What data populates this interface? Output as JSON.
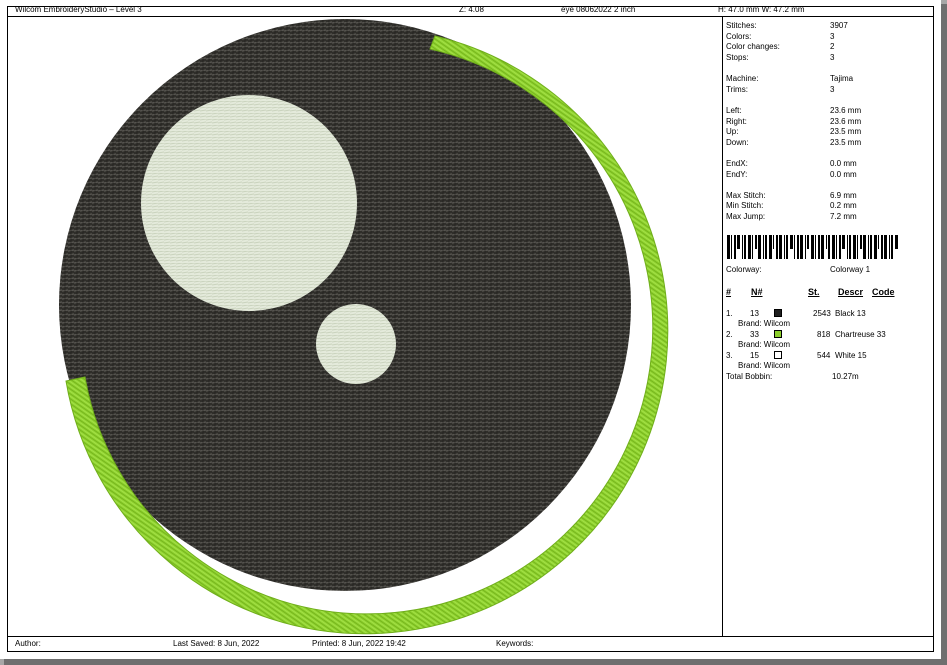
{
  "header": {
    "app_title": "Wilcom EmbroideryStudio – Level 3",
    "zoom": "Z: 4.08",
    "design_name": "eye 08062022 2 inch",
    "dimensions": "H: 47.0 mm   W: 47.2 mm"
  },
  "stats": [
    {
      "label": "Stitches:",
      "value": "3907"
    },
    {
      "label": "Colors:",
      "value": "3"
    },
    {
      "label": "Color changes:",
      "value": "2"
    },
    {
      "label": "Stops:",
      "value": "3"
    },
    {
      "label": "Machine:",
      "value": "Tajima"
    },
    {
      "label": "Trims:",
      "value": "3"
    },
    {
      "label": "Left:",
      "value": "23.6 mm"
    },
    {
      "label": "Right:",
      "value": "23.6 mm"
    },
    {
      "label": "Up:",
      "value": "23.5 mm"
    },
    {
      "label": "Down:",
      "value": "23.5 mm"
    },
    {
      "label": "EndX:",
      "value": "0.0 mm"
    },
    {
      "label": "EndY:",
      "value": "0.0 mm"
    },
    {
      "label": "Max Stitch:",
      "value": "6.9 mm"
    },
    {
      "label": "Min Stitch:",
      "value": "0.2 mm"
    },
    {
      "label": "Max Jump:",
      "value": "7.2 mm"
    }
  ],
  "colorway": {
    "label": "Colorway:",
    "value": "Colorway 1"
  },
  "table": {
    "headers": {
      "num": "#",
      "needle": "N#",
      "stitches": "St.",
      "descr": "Descr",
      "code": "Code"
    },
    "rows": [
      {
        "num": "1.",
        "needle": "13",
        "color": "#1f1f1f",
        "stitches": "2543",
        "descr": "Black 13",
        "brand": "Brand: Wilcom"
      },
      {
        "num": "2.",
        "needle": "33",
        "color": "#8ccf2c",
        "stitches": "818",
        "descr": "Chartreuse 33",
        "brand": "Brand: Wilcom"
      },
      {
        "num": "3.",
        "needle": "15",
        "color": "#ffffff",
        "stitches": "544",
        "descr": "White 15",
        "brand": "Brand: Wilcom"
      }
    ],
    "total_label": "Total Bobbin:",
    "total_value": "10.27m"
  },
  "footer": {
    "author": "Author:",
    "last_saved": "Last Saved:  8 Jun, 2022",
    "printed": "Printed:  8 Jun, 2022 19:42",
    "keywords": "Keywords:"
  },
  "colors": {
    "black_thread": "#2f2e2a",
    "green_thread": "#8fd22e",
    "white_thread": "#e4eadb"
  }
}
